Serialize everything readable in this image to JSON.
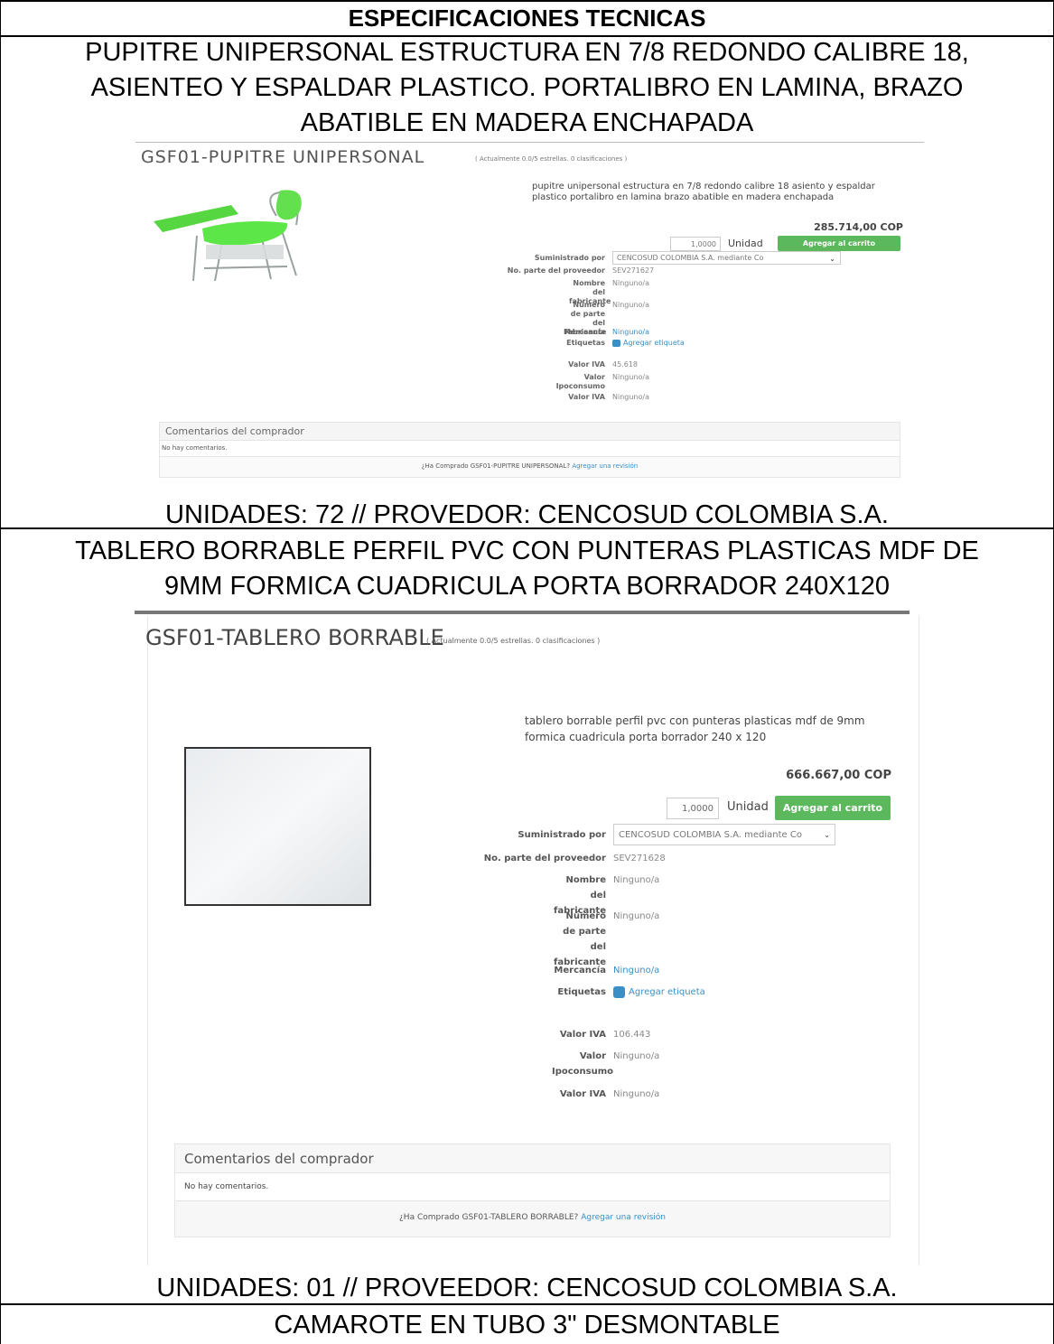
{
  "header": {
    "title": "ESPECIFICACIONES TECNICAS"
  },
  "item1": {
    "description_lines": [
      "PUPITRE UNIPERSONAL ESTRUCTURA EN 7/8 REDONDO CALIBRE 18,",
      "ASIENTEO Y ESPALDAR PLASTICO. PORTALIBRO EN LAMINA, BRAZO",
      "ABATIBLE EN MADERA ENCHAPADA"
    ],
    "footer": "UNIDADES:  72 // PROVEDOR: CENCOSUD COLOMBIA S.A.",
    "product": {
      "title": "GSF01-PUPITRE UNIPERSONAL",
      "rating": "( Actualmente 0.0/5 estrellas. 0 clasificaciones )",
      "description": "pupitre unipersonal estructura en 7/8 redondo calibre 18 asiento y espaldar plastico portalibro en lamina brazo abatible en madera enchapada",
      "price": "285.714,00 COP",
      "quantity": "1,0000",
      "unit": "Unidad",
      "add_to_cart": "Agregar al carrito",
      "supplied_by_label": "Suministrado por",
      "supplied_by_value": "CENCOSUD COLOMBIA S.A. mediante Co",
      "supplier_part_label": "No. parte del proveedor",
      "supplier_part_value": "SEV271627",
      "manufacturer_name_label": "Nombre del fabricante",
      "manufacturer_name_value": "Ninguno/a",
      "manufacturer_part_label": "Número de parte del fabricante",
      "manufacturer_part_value": "Ninguno/a",
      "merchandise_label": "Mercancía",
      "merchandise_value": "Ninguno/a",
      "tags_label": "Etiquetas",
      "tags_value": "Agregar etiqueta",
      "vat_label": "Valor IVA",
      "vat_value": "45.618",
      "ipoconsumo_label": "Valor Ipoconsumo",
      "ipoconsumo_value": "Ninguno/a",
      "vat2_label": "Valor IVA",
      "vat2_value": "Ninguno/a",
      "comments_header": "Comentarios del comprador",
      "no_comments": "No hay comentarios.",
      "review_question": "¿Ha Comprado GSF01-PUPITRE UNIPERSONAL?",
      "review_link": "Agregar una revisión"
    }
  },
  "item2": {
    "description_lines": [
      "TABLERO BORRABLE PERFIL PVC CON PUNTERAS PLASTICAS MDF DE",
      "9MM FORMICA CUADRICULA PORTA BORRADOR 240X120"
    ],
    "footer": "UNIDADES: 01 // PROVEEDOR: CENCOSUD COLOMBIA S.A.",
    "product": {
      "title": "GSF01-TABLERO BORRABLE",
      "rating": "( Actualmente 0.0/5 estrellas. 0 clasificaciones )",
      "description": "tablero borrable perfil pvc con punteras plasticas mdf de 9mm formica cuadricula porta borrador 240 x 120",
      "price": "666.667,00 COP",
      "quantity": "1,0000",
      "unit": "Unidad",
      "add_to_cart": "Agregar al carrito",
      "supplied_by_label": "Suministrado por",
      "supplied_by_value": "CENCOSUD COLOMBIA S.A. mediante Co",
      "supplier_part_label": "No. parte del proveedor",
      "supplier_part_value": "SEV271628",
      "manufacturer_name_label": "Nombre del fabricante",
      "manufacturer_name_value": "Ninguno/a",
      "manufacturer_part_label": "Número de parte del fabricante",
      "manufacturer_part_value": "Ninguno/a",
      "merchandise_label": "Mercancía",
      "merchandise_value": "Ninguno/a",
      "tags_label": "Etiquetas",
      "tags_value": "Agregar etiqueta",
      "vat_label": "Valor IVA",
      "vat_value": "106.443",
      "ipoconsumo_label": "Valor Ipoconsumo",
      "ipoconsumo_value": "Ninguno/a",
      "vat2_label": "Valor IVA",
      "vat2_value": "Ninguno/a",
      "comments_header": "Comentarios del comprador",
      "no_comments": "No hay comentarios.",
      "review_question": "¿Ha Comprado GSF01-TABLERO BORRABLE?",
      "review_link": "Agregar una revisión"
    }
  },
  "item3": {
    "description_lines": [
      "CAMAROTE EN TUBO 3\" DESMONTABLE"
    ]
  },
  "colors": {
    "accent_green": "#5cb85c",
    "link_blue": "#3a8fc7",
    "chair_green": "#5ee34a"
  }
}
